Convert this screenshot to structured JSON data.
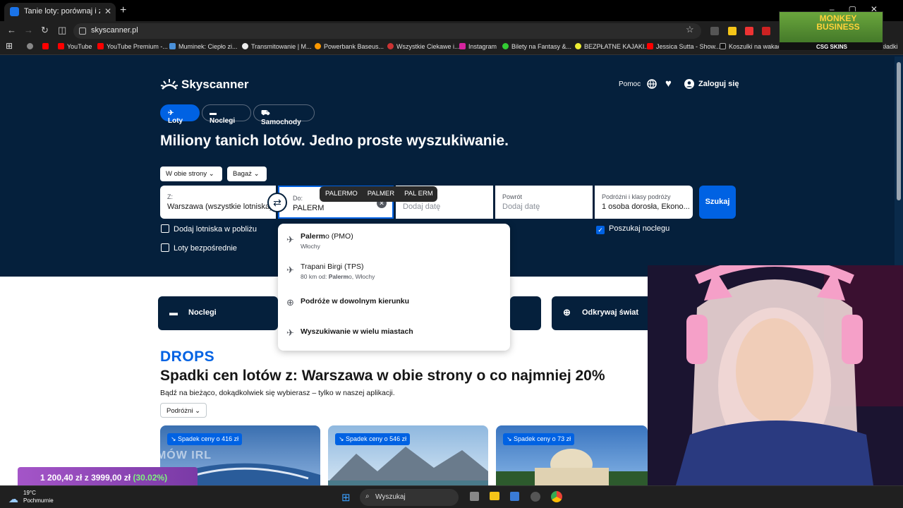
{
  "browser": {
    "tab_title": "Tanie loty: porównaj i zarezerw",
    "url": "skyscanner.pl",
    "bookmarks": [
      "YouTube",
      "YouTube Premium -...",
      "Muminek: Ciepło zi...",
      "Transmitowanie | M...",
      "Powerbank Baseus...",
      "Wszystkie Ciekawe i...",
      "Instagram",
      "Bilety na Fantasy &...",
      "BEZPŁATNE KAJAKI...",
      "Jessica Sutta - Show...",
      "Koszulki na wakacje..."
    ],
    "bookmark_cut": "zakładki"
  },
  "header": {
    "logo": "Skyscanner",
    "help": "Pomoc",
    "login": "Zaloguj się"
  },
  "nav": {
    "flights": "Loty",
    "hotels": "Noclegi",
    "cars": "Samochody"
  },
  "hero": {
    "headline": "Miliony tanich lotów. Jedno proste wyszukiwanie."
  },
  "search": {
    "trip_type": "W obie strony",
    "baggage": "Bagaż",
    "from_label": "Z:",
    "from_value": "Warszawa (wszystkie lotniska)",
    "to_label": "Do:",
    "to_value": "PALERM",
    "depart_placeholder": "Dodaj datę",
    "return_label": "Powrót",
    "return_placeholder": "Dodaj datę",
    "travellers_label": "Podróżni i klasy podróży",
    "travellers_value": "1 osoba dorosła, Ekono...",
    "search_button": "Szukaj",
    "nearby_airports": "Dodaj lotniska w pobliżu",
    "direct_flights": "Loty bezpośrednie",
    "search_hotels": "Poszukaj noclegu"
  },
  "autocomplete_suggestions": [
    "PALERMO",
    "PALMER",
    "PAL ERM"
  ],
  "dropdown": {
    "items": [
      {
        "main_bold": "Palerm",
        "main_rest": "o (PMO)",
        "sub": "Włochy"
      },
      {
        "main": "Trapani Birgi (TPS)",
        "sub_prefix": "80 km od: ",
        "sub_bold": "Palerm",
        "sub_rest": "o, Włochy"
      },
      {
        "main": "Podróże w dowolnym kierunku"
      },
      {
        "main": "Wyszukiwanie w wielu miastach"
      }
    ]
  },
  "cards": {
    "hotels": "Noclegi",
    "explore": "Odkrywaj świat"
  },
  "drops": {
    "brand": "DROPS",
    "title": "Spadki cen lotów z: Warszawa w obie strony o co najmniej 20%",
    "subtitle": "Bądź na bieżąco, dokądkolwiek się wybierasz – tylko w naszej aplikacji.",
    "travellers": "Podróżni",
    "deals": [
      {
        "badge": "Spadek ceny o 416 zł"
      },
      {
        "badge": "Spadek ceny o 546 zł"
      },
      {
        "badge": "Spadek ceny o 73 zł"
      }
    ]
  },
  "overlay": {
    "promo": "NOWY TEL DO STREAMÓW IRL",
    "current": "1 200,40 zł",
    "separator": "z",
    "goal": "3999,00 zł",
    "percent": "(30.02%)",
    "logo_title": "MONKEY BUSINESS",
    "logo_sub": "CSG SKINS"
  },
  "taskbar": {
    "temp": "19°C",
    "weather": "Pochmurnie",
    "search": "Wyszukaj"
  },
  "colors": {
    "brand_dark": "#05203c",
    "brand_blue": "#0062e3"
  }
}
